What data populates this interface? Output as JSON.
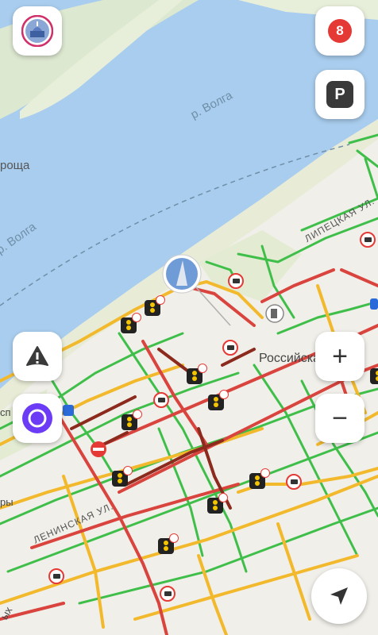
{
  "labels": {
    "river_top": "р. Волга",
    "river_left": "р. Волга",
    "left_edge": "роща",
    "lipetskaya": "ЛИПЕЦКАЯ УЛ.",
    "leninskaya": "ЛЕНИНСКАЯ УЛ.",
    "rossiyskaya": "Российская",
    "left_sp": "сп",
    "left_ry": "ры",
    "left_ykh": "ых"
  },
  "controls": {
    "traffic_score": "8",
    "parking_label": "P",
    "zoom_in": "+",
    "zoom_out": "−"
  },
  "icons": {
    "profile": "city-avatar-icon",
    "alert": "warning-triangle-icon",
    "assistant": "alice-assistant-icon",
    "navigate": "location-arrow-icon",
    "fuel": "fuel-station-icon",
    "no_entry": "no-entry-icon",
    "camera": "speed-camera-icon",
    "traffic_light": "traffic-light-icon",
    "bus": "bus-stop-icon"
  },
  "colors": {
    "water": "#a9cdee",
    "land": "#f1efe9",
    "traffic_green": "#3fbf4a",
    "traffic_yellow": "#f2b92d",
    "traffic_red": "#d9443e",
    "traffic_darkred": "#8b2a1d",
    "assistant_purple": "#6c3bf5"
  }
}
